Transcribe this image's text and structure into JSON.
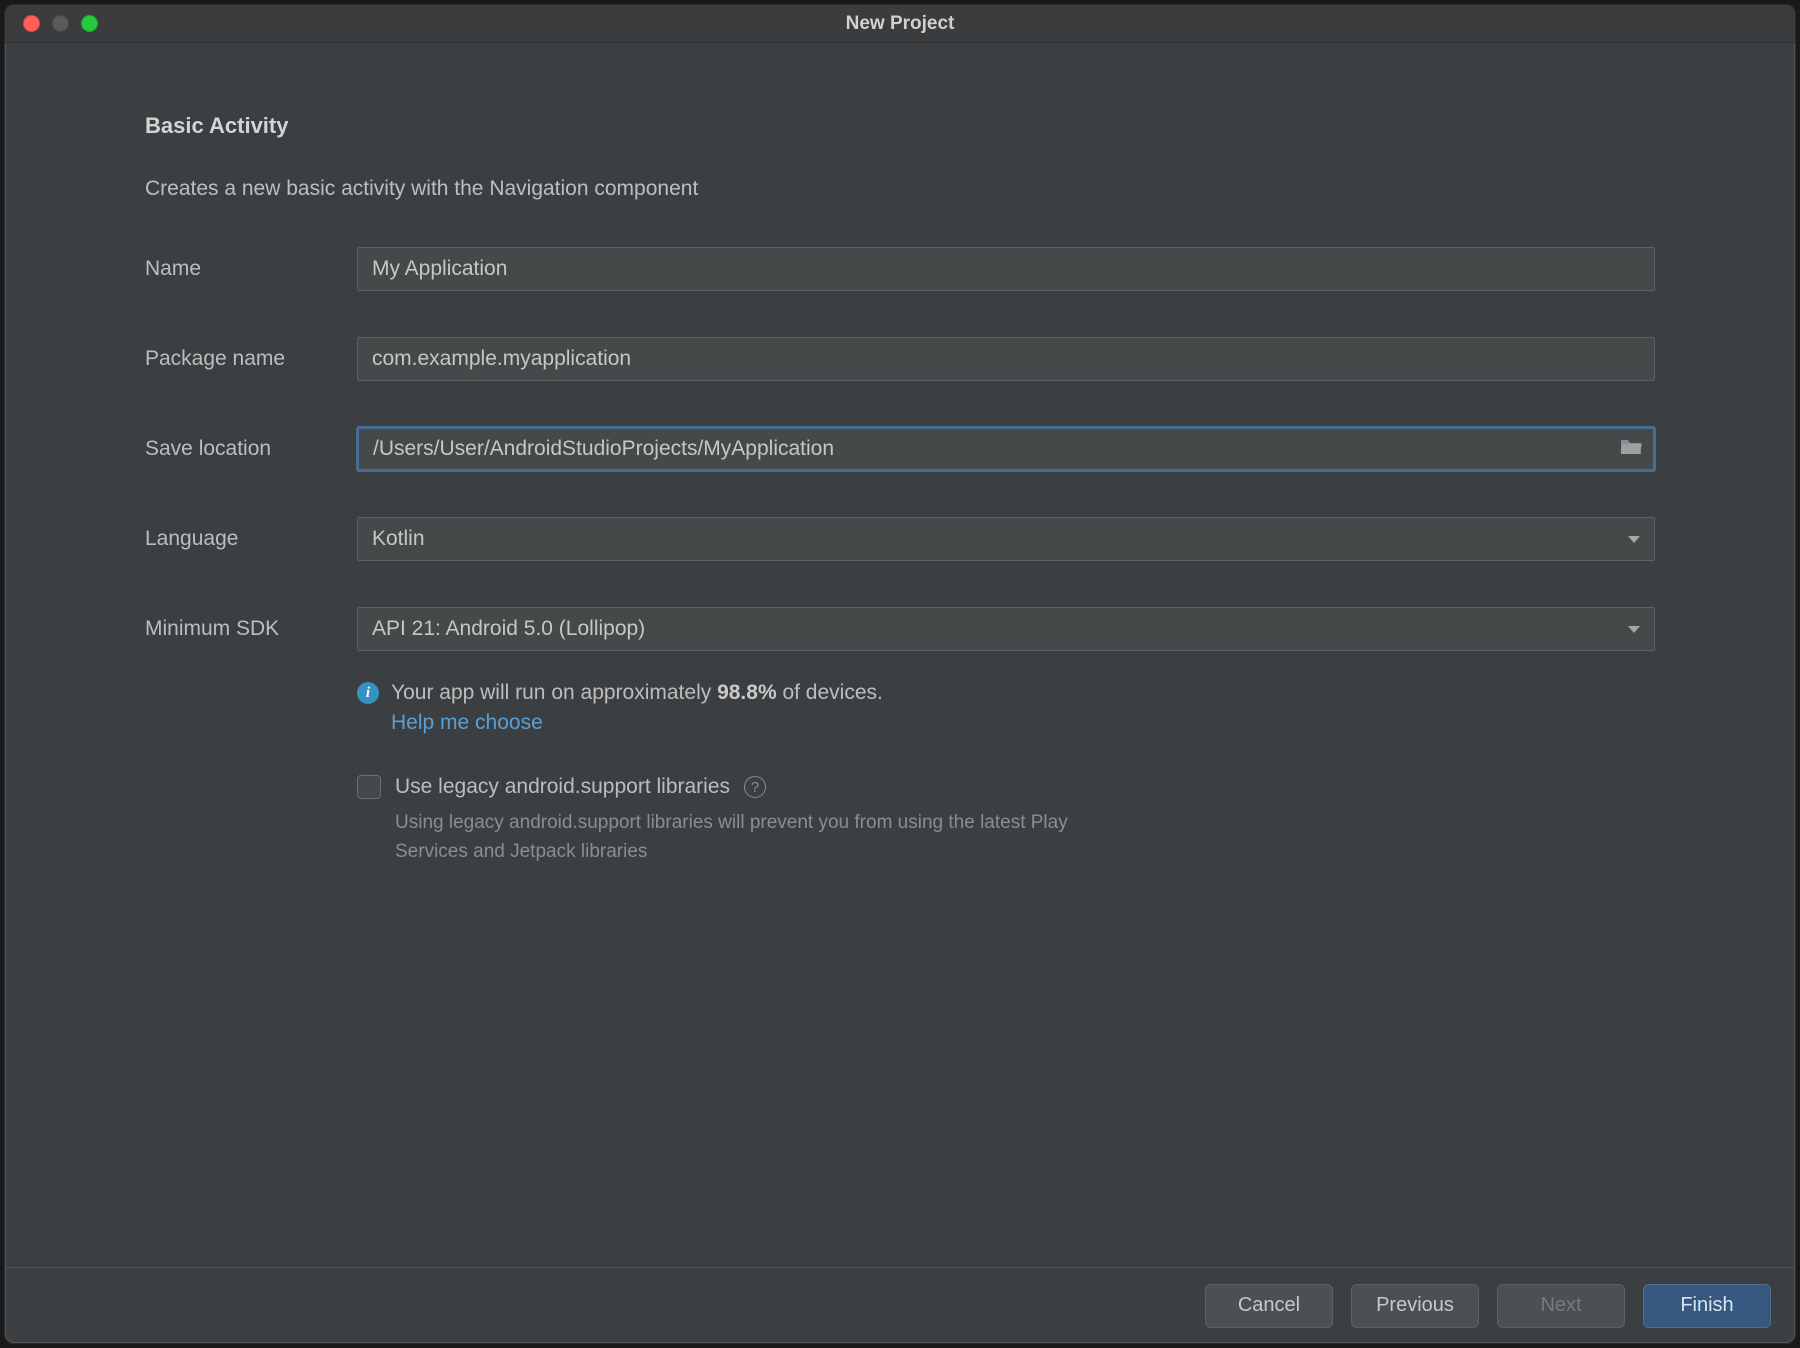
{
  "window": {
    "title": "New Project"
  },
  "page": {
    "heading": "Basic Activity",
    "description": "Creates a new basic activity with the Navigation component"
  },
  "form": {
    "name_label": "Name",
    "name_value": "My Application",
    "package_label": "Package name",
    "package_value": "com.example.myapplication",
    "location_label": "Save location",
    "location_value": "/Users/User/AndroidStudioProjects/MyApplication",
    "language_label": "Language",
    "language_value": "Kotlin",
    "sdk_label": "Minimum SDK",
    "sdk_value": "API 21: Android 5.0 (Lollipop)"
  },
  "info": {
    "prefix": "Your app will run on approximately ",
    "percent": "98.8%",
    "suffix": " of devices.",
    "help_link": "Help me choose"
  },
  "legacy": {
    "checkbox_label": "Use legacy android.support libraries",
    "note": "Using legacy android.support libraries will prevent you from using the latest Play Services and Jetpack libraries"
  },
  "buttons": {
    "cancel": "Cancel",
    "previous": "Previous",
    "next": "Next",
    "finish": "Finish"
  }
}
